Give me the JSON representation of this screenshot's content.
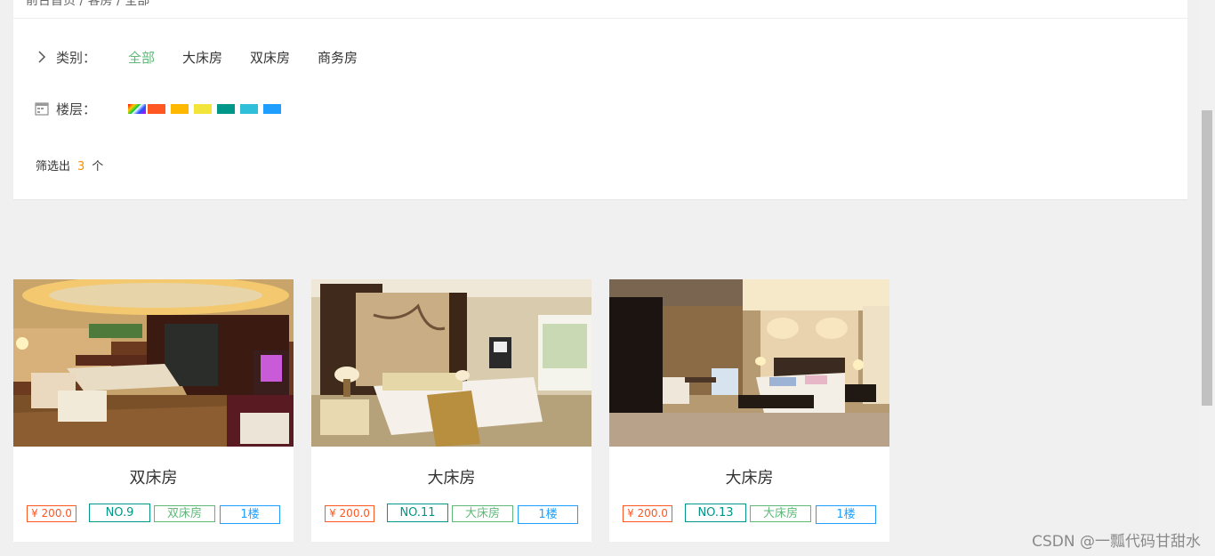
{
  "breadcrumb": {
    "text": "前台首页 / 客房 / 全部"
  },
  "filters": {
    "category": {
      "label": "类别：",
      "options": [
        "全部",
        "大床房",
        "双床房",
        "商务房"
      ],
      "selected": "全部"
    },
    "floor": {
      "label": "楼层：",
      "swatch_colors": [
        "#ff5722",
        "#ffb800",
        "#f3e43a",
        "#009688",
        "#2fbfd9",
        "#1e9fff"
      ]
    },
    "result": {
      "prefix": "筛选出",
      "count": "3",
      "suffix": "个"
    }
  },
  "rooms": [
    {
      "title": "双床房",
      "price": "¥ 200.0",
      "number": "NO.9",
      "type": "双床房",
      "floor": "1楼"
    },
    {
      "title": "大床房",
      "price": "¥ 200.0",
      "number": "NO.11",
      "type": "大床房",
      "floor": "1楼"
    },
    {
      "title": "大床房",
      "price": "¥ 200.0",
      "number": "NO.13",
      "type": "大床房",
      "floor": "1楼"
    }
  ],
  "watermark": "CSDN @一瓢代码甘甜水"
}
